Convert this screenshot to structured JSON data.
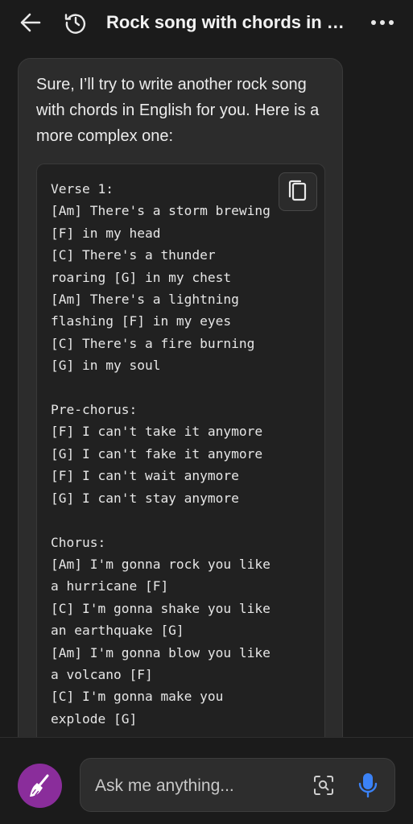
{
  "header": {
    "title": "Rock song with chords in English",
    "back_icon": "arrow-left-icon",
    "history_icon": "history-clock-icon",
    "more_icon": "more-horizontal-icon"
  },
  "message": {
    "intro": "Sure, I’ll try to write another rock song with chords in English for you. Here is a more complex one:",
    "code": "Verse 1:\n[Am] There's a storm brewing\n[F] in my head\n[C] There's a thunder\nroaring [G] in my chest\n[Am] There's a lightning\nflashing [F] in my eyes\n[C] There's a fire burning\n[G] in my soul\n\nPre-chorus:\n[F] I can't take it anymore\n[G] I can't fake it anymore\n[F] I can't wait anymore\n[G] I can't stay anymore\n\nChorus:\n[Am] I'm gonna rock you like\na hurricane [F]\n[C] I'm gonna shake you like\nan earthquake [G]\n[Am] I'm gonna blow you like\na volcano [F]\n[C] I'm gonna make you\nexplode [G]",
    "copy_icon": "copy-icon"
  },
  "composer": {
    "placeholder": "Ask me anything...",
    "new_topic_icon": "broom-icon",
    "camera_icon": "visual-search-icon",
    "mic_icon": "microphone-icon"
  },
  "colors": {
    "background": "#1b1b1b",
    "bubble": "#2c2c2c",
    "code_background": "#212121",
    "accent_purple": "#8a2d9b",
    "mic_blue": "#3b82f6"
  }
}
